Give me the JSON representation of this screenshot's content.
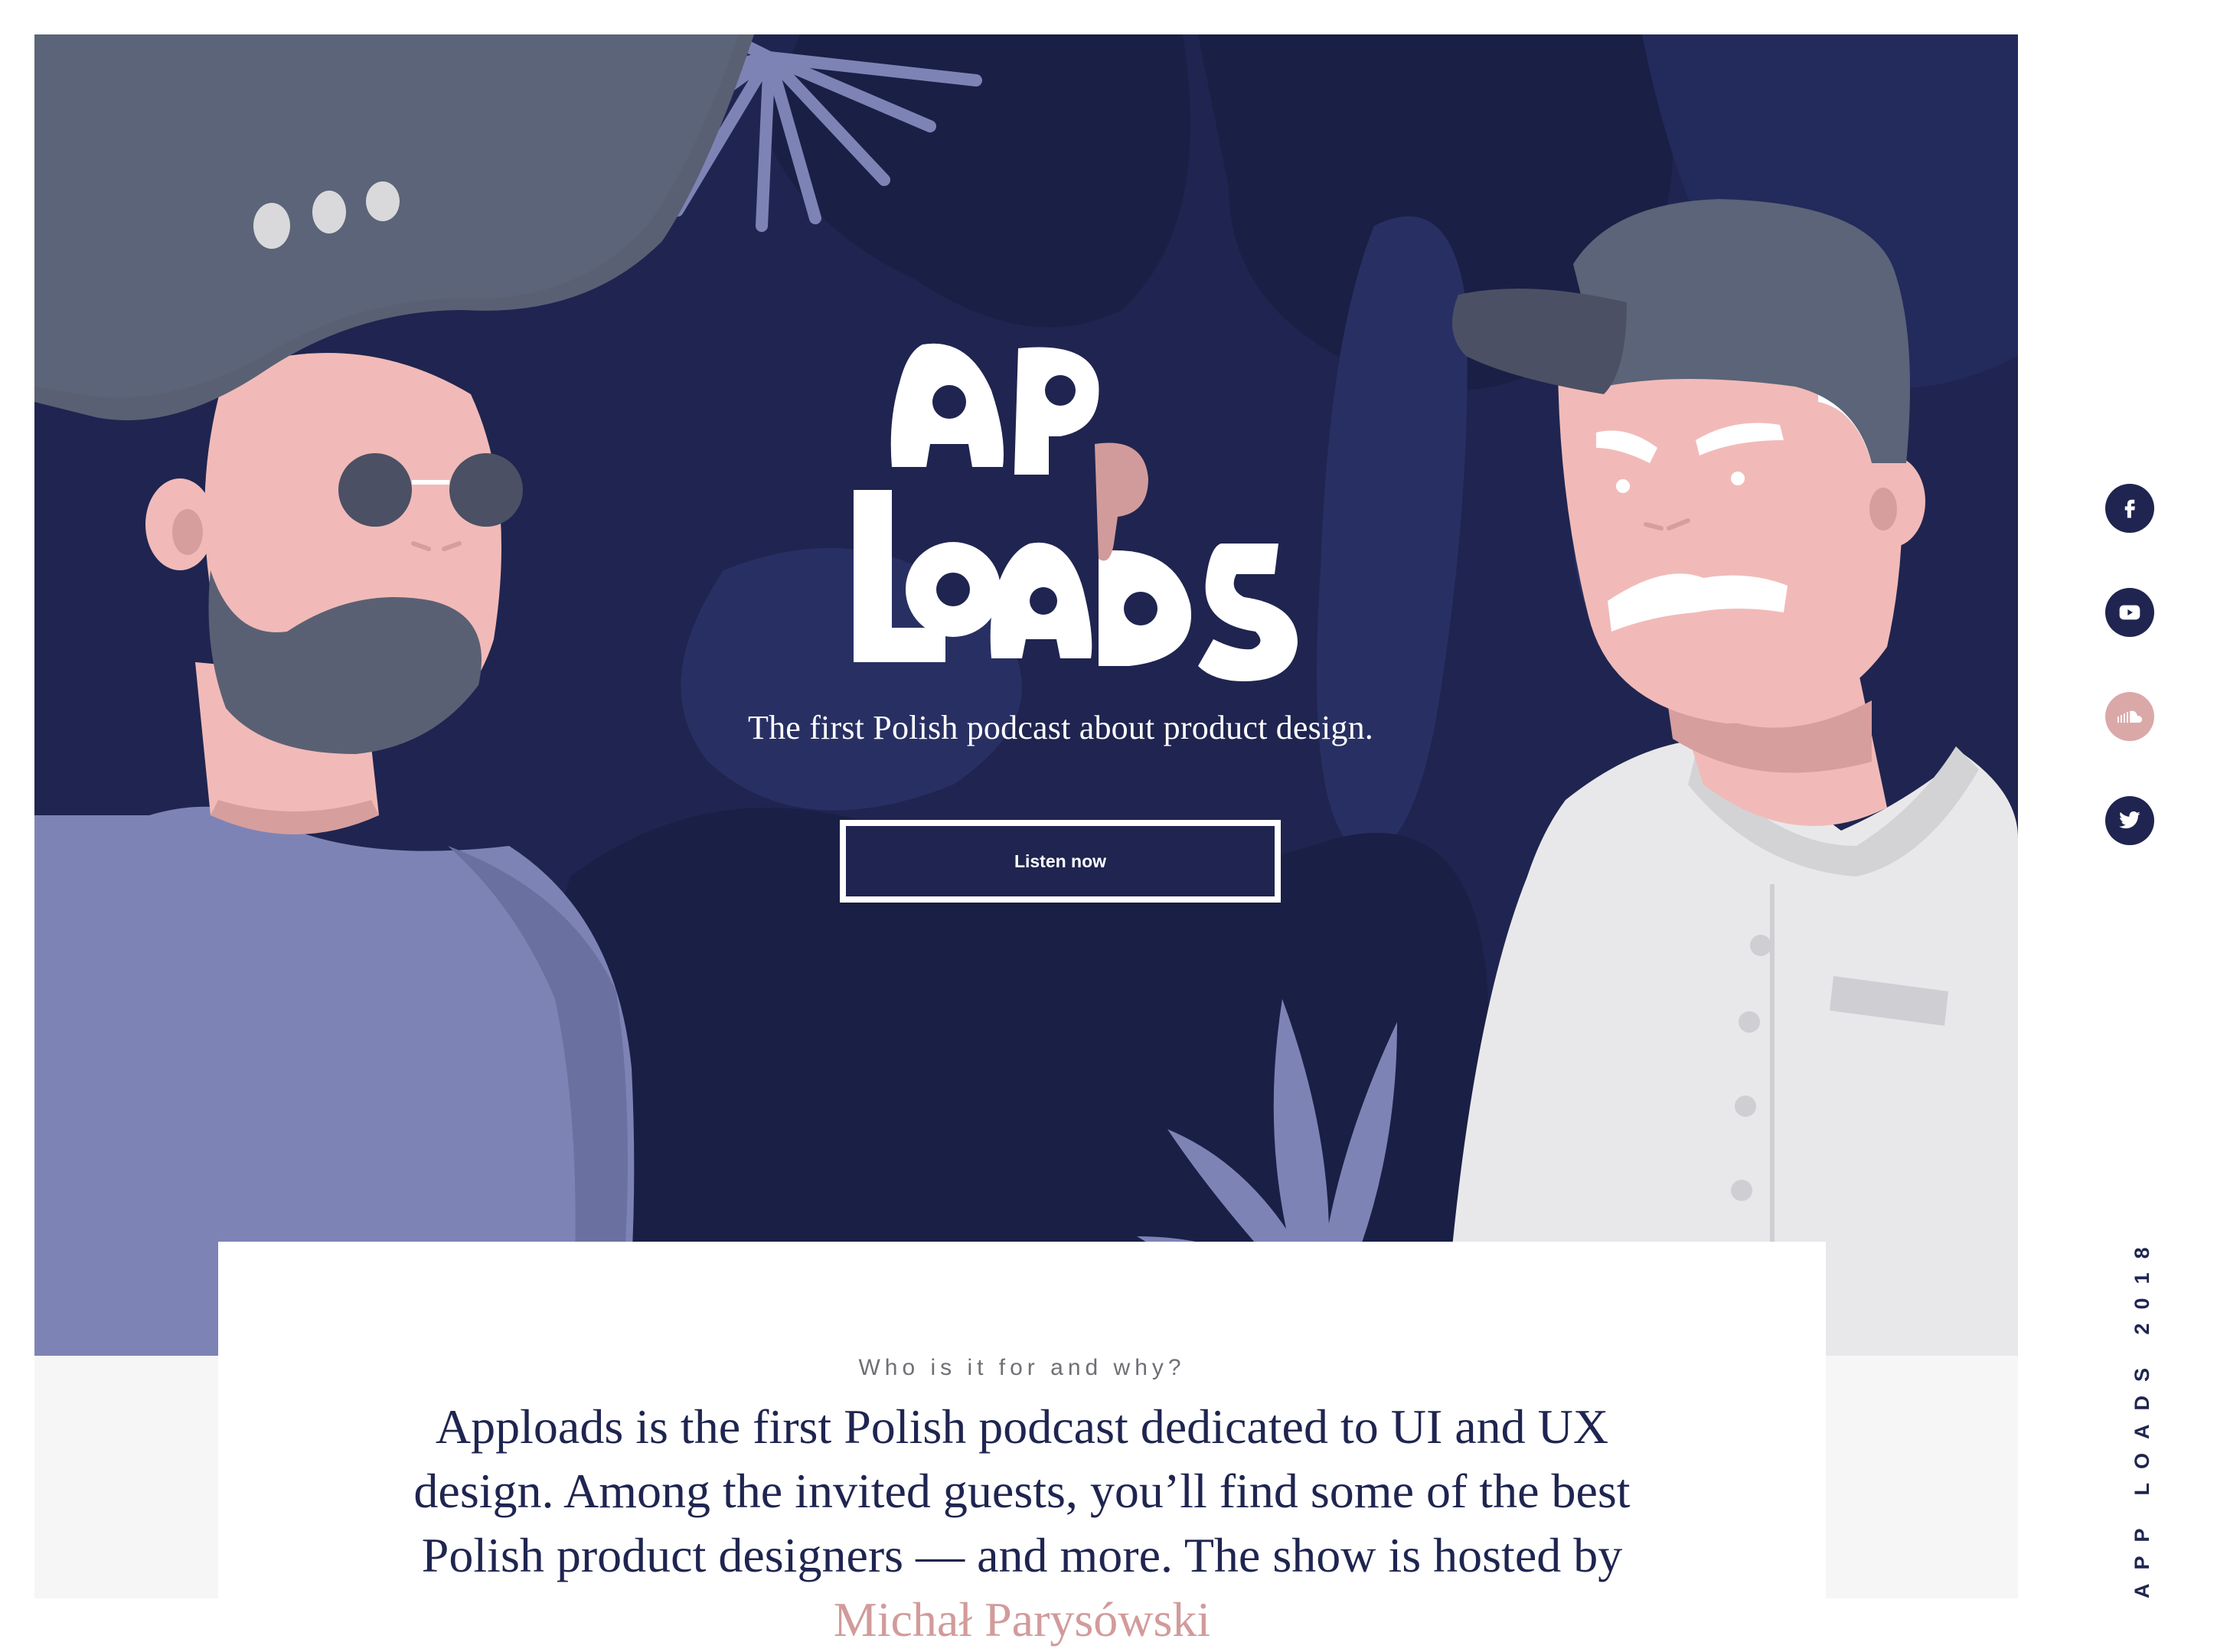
{
  "hero": {
    "logo_alt": "APP LOADS",
    "tagline": "The first Polish podcast about product design.",
    "cta_label": "Listen now"
  },
  "about": {
    "label": "Who is it for and why?",
    "text_part1": "Apploads is the first Polish podcast dedicated to UI and UX design. Among the invited guests, you’ll find some of the best Polish product designers — and more. The show is",
    "text_part2": "hosted by",
    "host_link": "Michał Parysówski"
  },
  "social": {
    "items": [
      {
        "name": "facebook",
        "icon": "facebook-icon"
      },
      {
        "name": "youtube",
        "icon": "youtube-icon"
      },
      {
        "name": "soundcloud",
        "icon": "soundcloud-icon"
      },
      {
        "name": "twitter",
        "icon": "twitter-icon"
      }
    ]
  },
  "side_label": "APP LOADS 2018",
  "colors": {
    "navy": "#1f2550",
    "accent_pink": "#d29b9b",
    "background_grey": "#f6f6f7"
  }
}
